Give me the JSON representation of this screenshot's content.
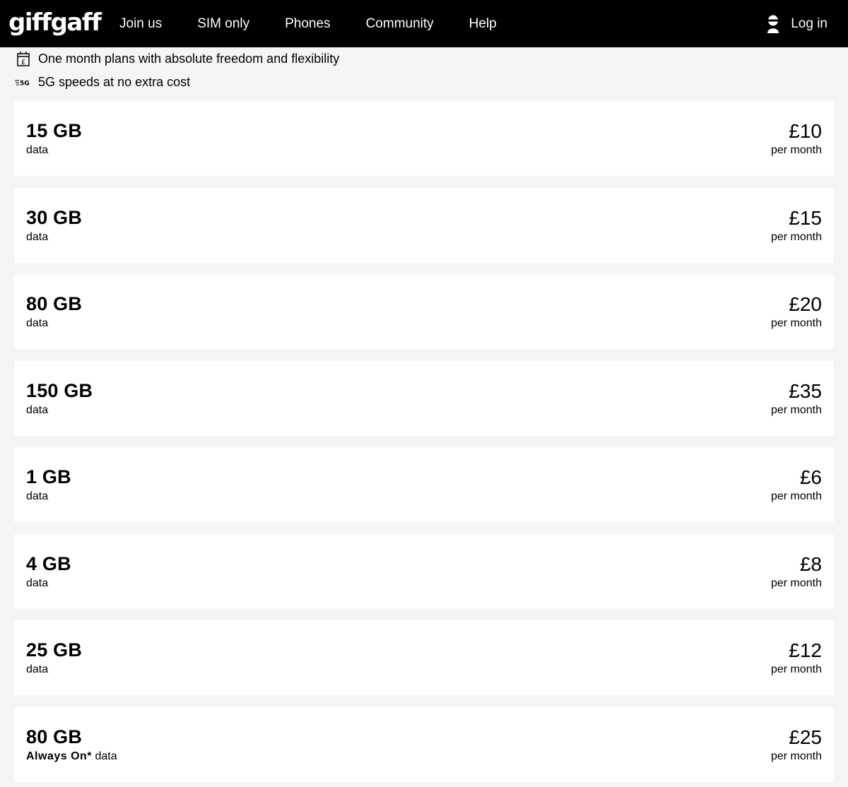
{
  "header": {
    "logo": "giffgaff",
    "nav": [
      "Join us",
      "SIM only",
      "Phones",
      "Community",
      "Help"
    ],
    "login_label": "Log in"
  },
  "features": [
    {
      "icon": "pound-calendar-icon",
      "text": "One month plans with absolute freedom and flexibility"
    },
    {
      "icon": "5g-icon",
      "text": "5G speeds at no extra cost"
    }
  ],
  "plans": [
    {
      "data": "15 GB",
      "sub_bold": "",
      "sub": "data",
      "price": "£10",
      "period": "per month"
    },
    {
      "data": "30 GB",
      "sub_bold": "",
      "sub": "data",
      "price": "£15",
      "period": "per month"
    },
    {
      "data": "80 GB",
      "sub_bold": "",
      "sub": "data",
      "price": "£20",
      "period": "per month"
    },
    {
      "data": "150 GB",
      "sub_bold": "",
      "sub": "data",
      "price": "£35",
      "period": "per month"
    },
    {
      "data": "1 GB",
      "sub_bold": "",
      "sub": "data",
      "price": "£6",
      "period": "per month"
    },
    {
      "data": "4 GB",
      "sub_bold": "",
      "sub": "data",
      "price": "£8",
      "period": "per month"
    },
    {
      "data": "25 GB",
      "sub_bold": "",
      "sub": "data",
      "price": "£12",
      "period": "per month"
    },
    {
      "data": "80 GB",
      "sub_bold": "Always On*",
      "sub": " data",
      "price": "£25",
      "period": "per month"
    }
  ],
  "colors": {
    "header_bg": "#000000",
    "page_bg": "#f5f5f5",
    "card_bg": "#ffffff"
  }
}
